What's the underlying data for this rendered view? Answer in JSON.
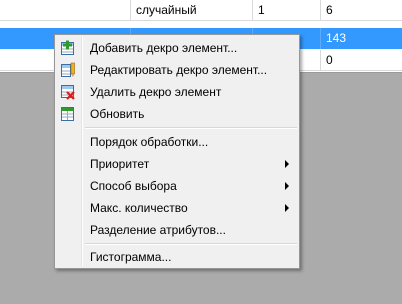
{
  "grid": {
    "rows": [
      {
        "c0": "",
        "c1": "случайный",
        "c2": "1",
        "c3": "6",
        "selected": false
      },
      {
        "c0": "",
        "c1": "",
        "c2": "",
        "c3": "143",
        "selected": true
      },
      {
        "c0": "",
        "c1": "",
        "c2": "",
        "c3": "0",
        "selected": false
      }
    ]
  },
  "menu": {
    "add": "Добавить декро элемент...",
    "edit": "Редактировать декро элемент...",
    "delete": "Удалить декро элемент",
    "refresh": "Обновить",
    "processing_order": "Порядок обработки...",
    "priority": "Приоритет",
    "selection_method": "Способ выбора",
    "max_count": "Макс. количество",
    "attribute_split": "Разделение атрибутов...",
    "histogram": "Гистограмма..."
  },
  "colors": {
    "selection": "#3399ff",
    "menu_bg": "#f0f0f0",
    "app_bg": "#ababab"
  }
}
